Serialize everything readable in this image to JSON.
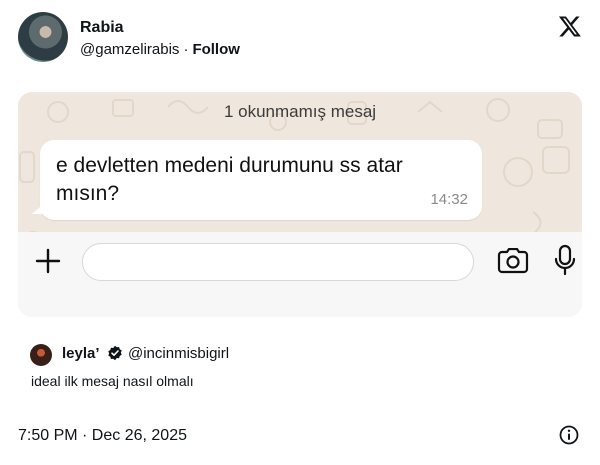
{
  "post": {
    "author_name": "Rabia",
    "author_handle": "@gamzelirabis",
    "separator": "·",
    "follow_label": "Follow",
    "timestamp": "7:50 PM · Dec 26, 2025"
  },
  "chat": {
    "unread_banner": "1 okunmamış mesaj",
    "message_text": "e devletten medeni durumunu ss atar mısın?",
    "message_time": "14:32",
    "input_value": ""
  },
  "quote": {
    "name": "leyla’",
    "handle": "@incinmisbigirl",
    "text": "ideal ilk mesaj nasıl olmalı"
  },
  "icons": {
    "x_logo": "x-logo-icon",
    "plus": "plus-icon",
    "sticker": "sticker-icon",
    "camera": "camera-icon",
    "microphone": "microphone-icon",
    "verified": "verified-badge-icon",
    "info": "info-icon"
  },
  "colors": {
    "chat_background": "#efe7de",
    "bubble": "#ffffff",
    "composer": "#f7f7f7",
    "text": "#0f1419"
  }
}
